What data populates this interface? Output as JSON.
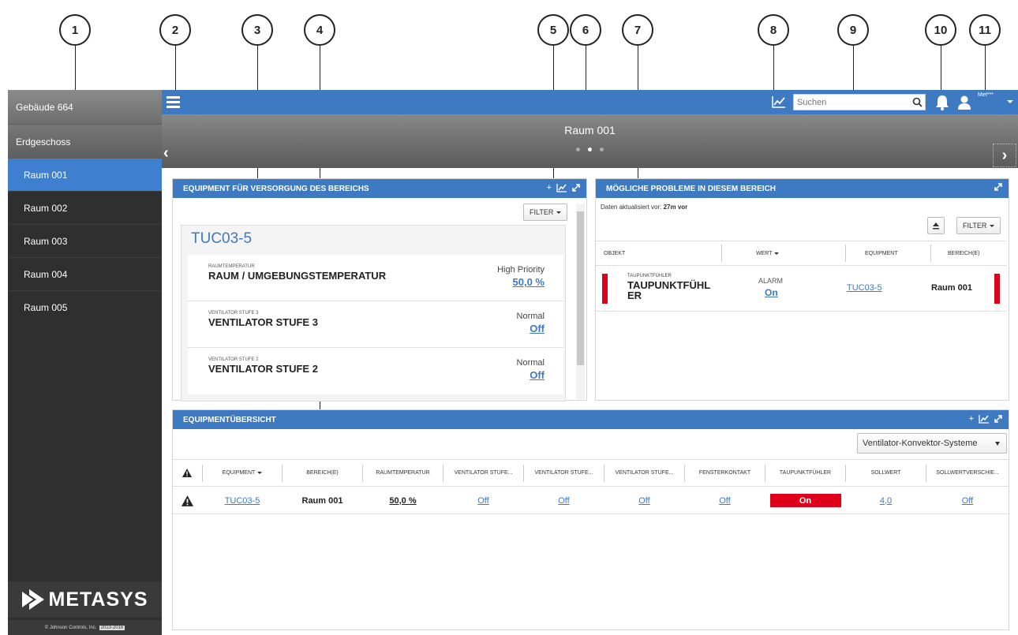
{
  "callouts": [
    "1",
    "2",
    "3",
    "4",
    "5",
    "6",
    "7",
    "8",
    "9",
    "10",
    "11"
  ],
  "sidebar": {
    "building": "Gebäude 664",
    "floor": "Erdgeschoss",
    "items": [
      {
        "label": "Raum 001"
      },
      {
        "label": "Raum 002"
      },
      {
        "label": "Raum 003"
      },
      {
        "label": "Raum 004"
      },
      {
        "label": "Raum 005"
      }
    ],
    "logo_text": "METASYS",
    "copyright": "© Johnson Controls, Inc.",
    "copyright_years": "2013-2016"
  },
  "topbar": {
    "search_placeholder": "Suchen",
    "user_name": "Met***"
  },
  "banner": {
    "title": "Raum 001",
    "page_dots": 3,
    "active_dot": 1
  },
  "equipment_panel": {
    "title": "EQUIPMENT FÜR VERSORGUNG DES BEREICHS",
    "add_label": "+",
    "filter_label": "FILTER",
    "equipment_name": "TUC03-5",
    "rows": [
      {
        "small": "RAUMTEMPERATUR",
        "name": "RAUM / UMGEBUNGSTEMPERATUR",
        "priority": "High Priority",
        "value": "50,0 %"
      },
      {
        "small": "VENTILATOR STUFE 3",
        "name": "VENTILATOR STUFE 3",
        "priority": "Normal",
        "value": "Off"
      },
      {
        "small": "VENTILATOR STUFE 2",
        "name": "VENTILATOR STUFE 2",
        "priority": "Normal",
        "value": "Off"
      }
    ]
  },
  "problems_panel": {
    "title": "MÖGLICHE PROBLEME IN DIESEM BEREICH",
    "updated_label": "Daten aktualisiert vor:",
    "updated_value": "27m vor",
    "filter_label": "FILTER",
    "columns": [
      "OBJEKT",
      "WERT",
      "EQUIPMENT",
      "BEREICH(E)"
    ],
    "row": {
      "object_small": "TAUPUNKTFÜHLER",
      "object_name": "TAUPUNKTFÜHL ER",
      "status": "ALARM",
      "value": "On",
      "equipment": "TUC03-5",
      "area": "Raum 001"
    }
  },
  "overview_panel": {
    "title": "EQUIPMENTÜBERSICHT",
    "add_label": "+",
    "select_value": "Ventilator-Konvektor-Systeme",
    "columns": [
      "EQUIPMENT",
      "BEREICH(E)",
      "RAUMTEMPERATUR",
      "VENTILATOR STUFE...",
      "VENTILATOR STUFE...",
      "VENTILATOR STUFE...",
      "FENSTERKONTAKT",
      "TAUPUNKTFÜHLER",
      "SOLLWERT",
      "SOLLWERTVERSCHIE..."
    ],
    "row": {
      "equipment": "TUC03-5",
      "area": "Raum 001",
      "room_temp": "50,0 %",
      "fan1": "Off",
      "fan2": "Off",
      "fan3": "Off",
      "window": "Off",
      "dewpoint": "On",
      "setpoint": "4,0",
      "setpoint_shift": "Off"
    }
  },
  "colors": {
    "accent": "#3e7ac1",
    "alarm": "#e0001a",
    "sidebar": "#2f2f2f"
  }
}
